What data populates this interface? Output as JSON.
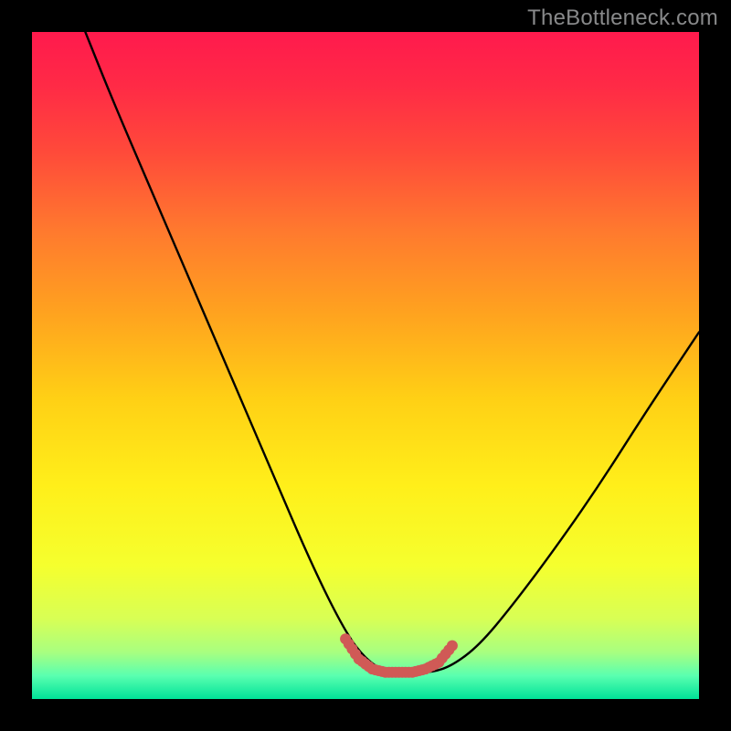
{
  "watermark": {
    "text": "TheBottleneck.com"
  },
  "gradient": {
    "stops": [
      {
        "offset": 0.0,
        "color": "#ff1a4d"
      },
      {
        "offset": 0.08,
        "color": "#ff2a46"
      },
      {
        "offset": 0.18,
        "color": "#ff4a3a"
      },
      {
        "offset": 0.3,
        "color": "#ff7a2e"
      },
      {
        "offset": 0.42,
        "color": "#ffa21f"
      },
      {
        "offset": 0.55,
        "color": "#ffd015"
      },
      {
        "offset": 0.68,
        "color": "#ffef1a"
      },
      {
        "offset": 0.8,
        "color": "#f5ff2e"
      },
      {
        "offset": 0.88,
        "color": "#d8ff55"
      },
      {
        "offset": 0.93,
        "color": "#a8ff80"
      },
      {
        "offset": 0.965,
        "color": "#5affb0"
      },
      {
        "offset": 1.0,
        "color": "#00e298"
      }
    ]
  },
  "chart_data": {
    "type": "line",
    "title": "",
    "xlabel": "",
    "ylabel": "",
    "xlim": [
      0,
      100
    ],
    "ylim": [
      0,
      100
    ],
    "series": [
      {
        "name": "bottleneck-curve",
        "x": [
          8,
          12,
          18,
          24,
          30,
          36,
          42,
          47,
          50,
          53,
          57,
          60,
          63,
          67,
          72,
          78,
          85,
          92,
          100
        ],
        "y": [
          100,
          90,
          76,
          62,
          48,
          34,
          20,
          10,
          6,
          4,
          4,
          4,
          5,
          8,
          14,
          22,
          32,
          43,
          55
        ]
      }
    ],
    "marker_region": {
      "name": "optimal-zone",
      "color": "#d05a56",
      "x": [
        47,
        49,
        51,
        53,
        55,
        57,
        59,
        61,
        63
      ],
      "y": [
        9,
        6,
        4.5,
        4,
        4,
        4,
        4.5,
        5.5,
        8
      ]
    }
  }
}
